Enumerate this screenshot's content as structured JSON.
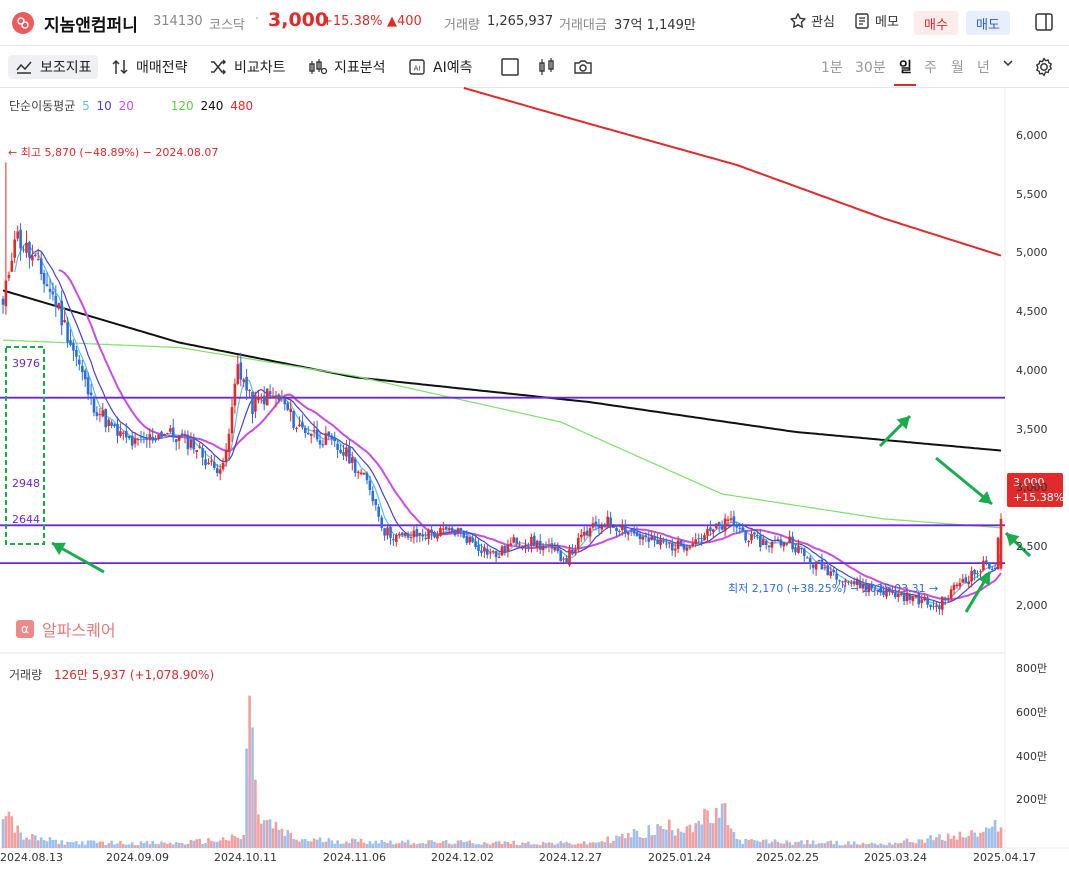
{
  "header": {
    "name": "지놈앤컴퍼니",
    "code": "314130",
    "market": "코스닥",
    "price": "3,000",
    "change_pct": "+15.38%",
    "change": "▲400",
    "volume_label": "거래량",
    "volume": "1,265,937",
    "amount_label": "거래대금",
    "amount": "37억 1,149만",
    "watch_label": "관심",
    "memo_label": "메모",
    "buy_label": "매수",
    "sell_label": "매도"
  },
  "toolbar": {
    "items": [
      "보조지표",
      "매매전략",
      "비교차트",
      "지표분석",
      "AI예측"
    ],
    "periods": [
      "1분",
      "30분",
      "일",
      "주",
      "월",
      "년"
    ],
    "active_period": "일"
  },
  "indicator": {
    "name": "단순이동평균",
    "periods": [
      "5",
      "10",
      "20",
      "120",
      "240",
      "480"
    ]
  },
  "annotations": {
    "high": "← 최고 5,870 (−48.89%) − 2024.08.07",
    "low": "최저 2,170 (+38.25%) − 2025.03.31 →",
    "hlines": [
      "3976",
      "2948",
      "2644"
    ],
    "price_tag_value": "3,000",
    "price_tag_pct": "+15.38%",
    "watermark": "알파스퀘어"
  },
  "volume_legend": {
    "label": "거래량",
    "value": "126만 5,937 (+1,078.90%)"
  },
  "colors": {
    "up": "#e22a2a",
    "down": "#2a6ee2",
    "ma5": "#5bc0eb",
    "ma10": "#4b3fcf",
    "ma20": "#c94ee0",
    "ma120": "#7ee06a",
    "ma240": "#111111",
    "ma480": "#e22a2a",
    "hline": "#6a28d8",
    "arrow": "#1aab4a"
  },
  "chart_data": {
    "type": "candlestick",
    "title": "",
    "y_ticks": [
      "6,000",
      "5,500",
      "5,000",
      "4,500",
      "4,000",
      "3,500",
      "3,000",
      "2,500",
      "2,000"
    ],
    "ylim": [
      1960,
      6470
    ],
    "x_ticks": [
      "2024.08.13",
      "2024.09.09",
      "2024.10.11",
      "2024.11.06",
      "2024.12.02",
      "2024.12.27",
      "2025.01.24",
      "2025.02.25",
      "2025.03.24",
      "2025.04.17"
    ],
    "volume_ticks": [
      "800만",
      "600만",
      "400만",
      "200만"
    ],
    "volume_ylim": [
      0,
      8200000
    ],
    "horizontal_lines": [
      3976,
      2948,
      2644
    ],
    "high": {
      "value": 5870,
      "date": "2024.08.07"
    },
    "low": {
      "value": 2170,
      "date": "2025.03.31"
    },
    "last_close": 3000,
    "ma_anchors": {
      "ma120": [
        [
          0,
          4440
        ],
        [
          60,
          4380
        ],
        [
          120,
          4150
        ],
        [
          190,
          3780
        ],
        [
          245,
          3200
        ],
        [
          300,
          3000
        ],
        [
          340,
          2928
        ]
      ],
      "ma240": [
        [
          0,
          4840
        ],
        [
          60,
          4420
        ],
        [
          120,
          4140
        ],
        [
          200,
          3940
        ],
        [
          270,
          3700
        ],
        [
          340,
          3550
        ]
      ],
      "ma480": [
        [
          157,
          6470
        ],
        [
          200,
          6180
        ],
        [
          250,
          5850
        ],
        [
          300,
          5420
        ],
        [
          340,
          5120
        ]
      ]
    },
    "candles_anchors": [
      [
        0,
        4700
      ],
      [
        4,
        5300
      ],
      [
        10,
        5100
      ],
      [
        18,
        4750
      ],
      [
        25,
        4300
      ],
      [
        30,
        3950
      ],
      [
        38,
        3700
      ],
      [
        45,
        3600
      ],
      [
        55,
        3700
      ],
      [
        65,
        3600
      ],
      [
        72,
        3400
      ],
      [
        76,
        3500
      ],
      [
        80,
        4250
      ],
      [
        85,
        3900
      ],
      [
        90,
        4000
      ],
      [
        95,
        3950
      ],
      [
        100,
        3750
      ],
      [
        105,
        3700
      ],
      [
        112,
        3600
      ],
      [
        118,
        3500
      ],
      [
        125,
        3250
      ],
      [
        130,
        2900
      ],
      [
        135,
        2850
      ],
      [
        145,
        2880
      ],
      [
        155,
        2900
      ],
      [
        162,
        2780
      ],
      [
        168,
        2700
      ],
      [
        175,
        2830
      ],
      [
        182,
        2800
      ],
      [
        192,
        2680
      ],
      [
        198,
        2870
      ],
      [
        205,
        2980
      ],
      [
        212,
        2920
      ],
      [
        220,
        2820
      ],
      [
        230,
        2780
      ],
      [
        240,
        2880
      ],
      [
        248,
        2980
      ],
      [
        255,
        2830
      ],
      [
        262,
        2800
      ],
      [
        268,
        2830
      ],
      [
        275,
        2650
      ],
      [
        282,
        2580
      ],
      [
        290,
        2480
      ],
      [
        298,
        2430
      ],
      [
        305,
        2390
      ],
      [
        312,
        2350
      ],
      [
        318,
        2290
      ],
      [
        322,
        2380
      ],
      [
        326,
        2500
      ],
      [
        331,
        2560
      ],
      [
        335,
        2640
      ],
      [
        338,
        2620
      ],
      [
        340,
        3000
      ]
    ],
    "volume_anchors": [
      [
        0,
        2000000
      ],
      [
        6,
        500000
      ],
      [
        20,
        250000
      ],
      [
        60,
        200000
      ],
      [
        82,
        450000
      ],
      [
        84,
        7800000
      ],
      [
        85,
        4000000
      ],
      [
        86,
        2400000
      ],
      [
        88,
        1200000
      ],
      [
        100,
        350000
      ],
      [
        140,
        250000
      ],
      [
        200,
        200000
      ],
      [
        247,
        1400000
      ],
      [
        250,
        300000
      ],
      [
        300,
        180000
      ],
      [
        336,
        650000
      ],
      [
        340,
        1265937
      ]
    ]
  }
}
